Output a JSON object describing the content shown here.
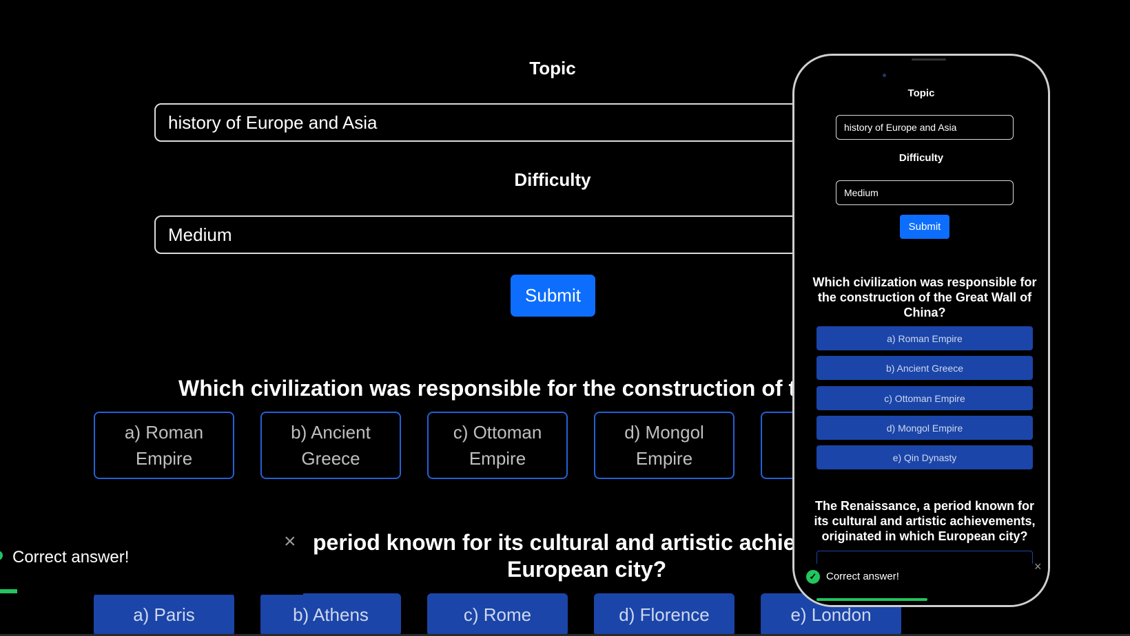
{
  "main": {
    "topic_label": "Topic",
    "topic_value": "history of Europe and Asia",
    "difficulty_label": "Difficulty",
    "difficulty_value": "Medium",
    "submit_label": "Submit",
    "question1": "Which civilization was responsible for the construction of the G",
    "question1_options": [
      "a) Roman Empire",
      "b) Ancient Greece",
      "c) Ottoman Empire",
      "d) Mongol Empire"
    ],
    "question2_line1": "period known for its cultural and artistic achieven",
    "question2_line2": "European city?",
    "question2_options": [
      "a) Paris",
      "b) Athens",
      "c) Rome",
      "d) Florence",
      "e) London"
    ],
    "toast_text": "Correct answer!",
    "toast_close": "×"
  },
  "phone": {
    "topic_label": "Topic",
    "topic_value": "history of Europe and Asia",
    "difficulty_label": "Difficulty",
    "difficulty_value": "Medium",
    "submit_label": "Submit",
    "question1": "Which civilization was responsible for the construction of the Great Wall of China?",
    "question1_options": [
      "a) Roman Empire",
      "b) Ancient Greece",
      "c) Ottoman Empire",
      "d) Mongol Empire",
      "e) Qin Dynasty"
    ],
    "question2": "The Renaissance, a period known for its cultural and artistic achievements, originated in which European city?",
    "toast_text": "Correct answer!",
    "toast_close": "×"
  },
  "colors": {
    "background": "#000000",
    "primary": "#0d6efd",
    "option_fill": "#1b45a8",
    "option_border": "#2361d6",
    "success": "#22c55e"
  }
}
